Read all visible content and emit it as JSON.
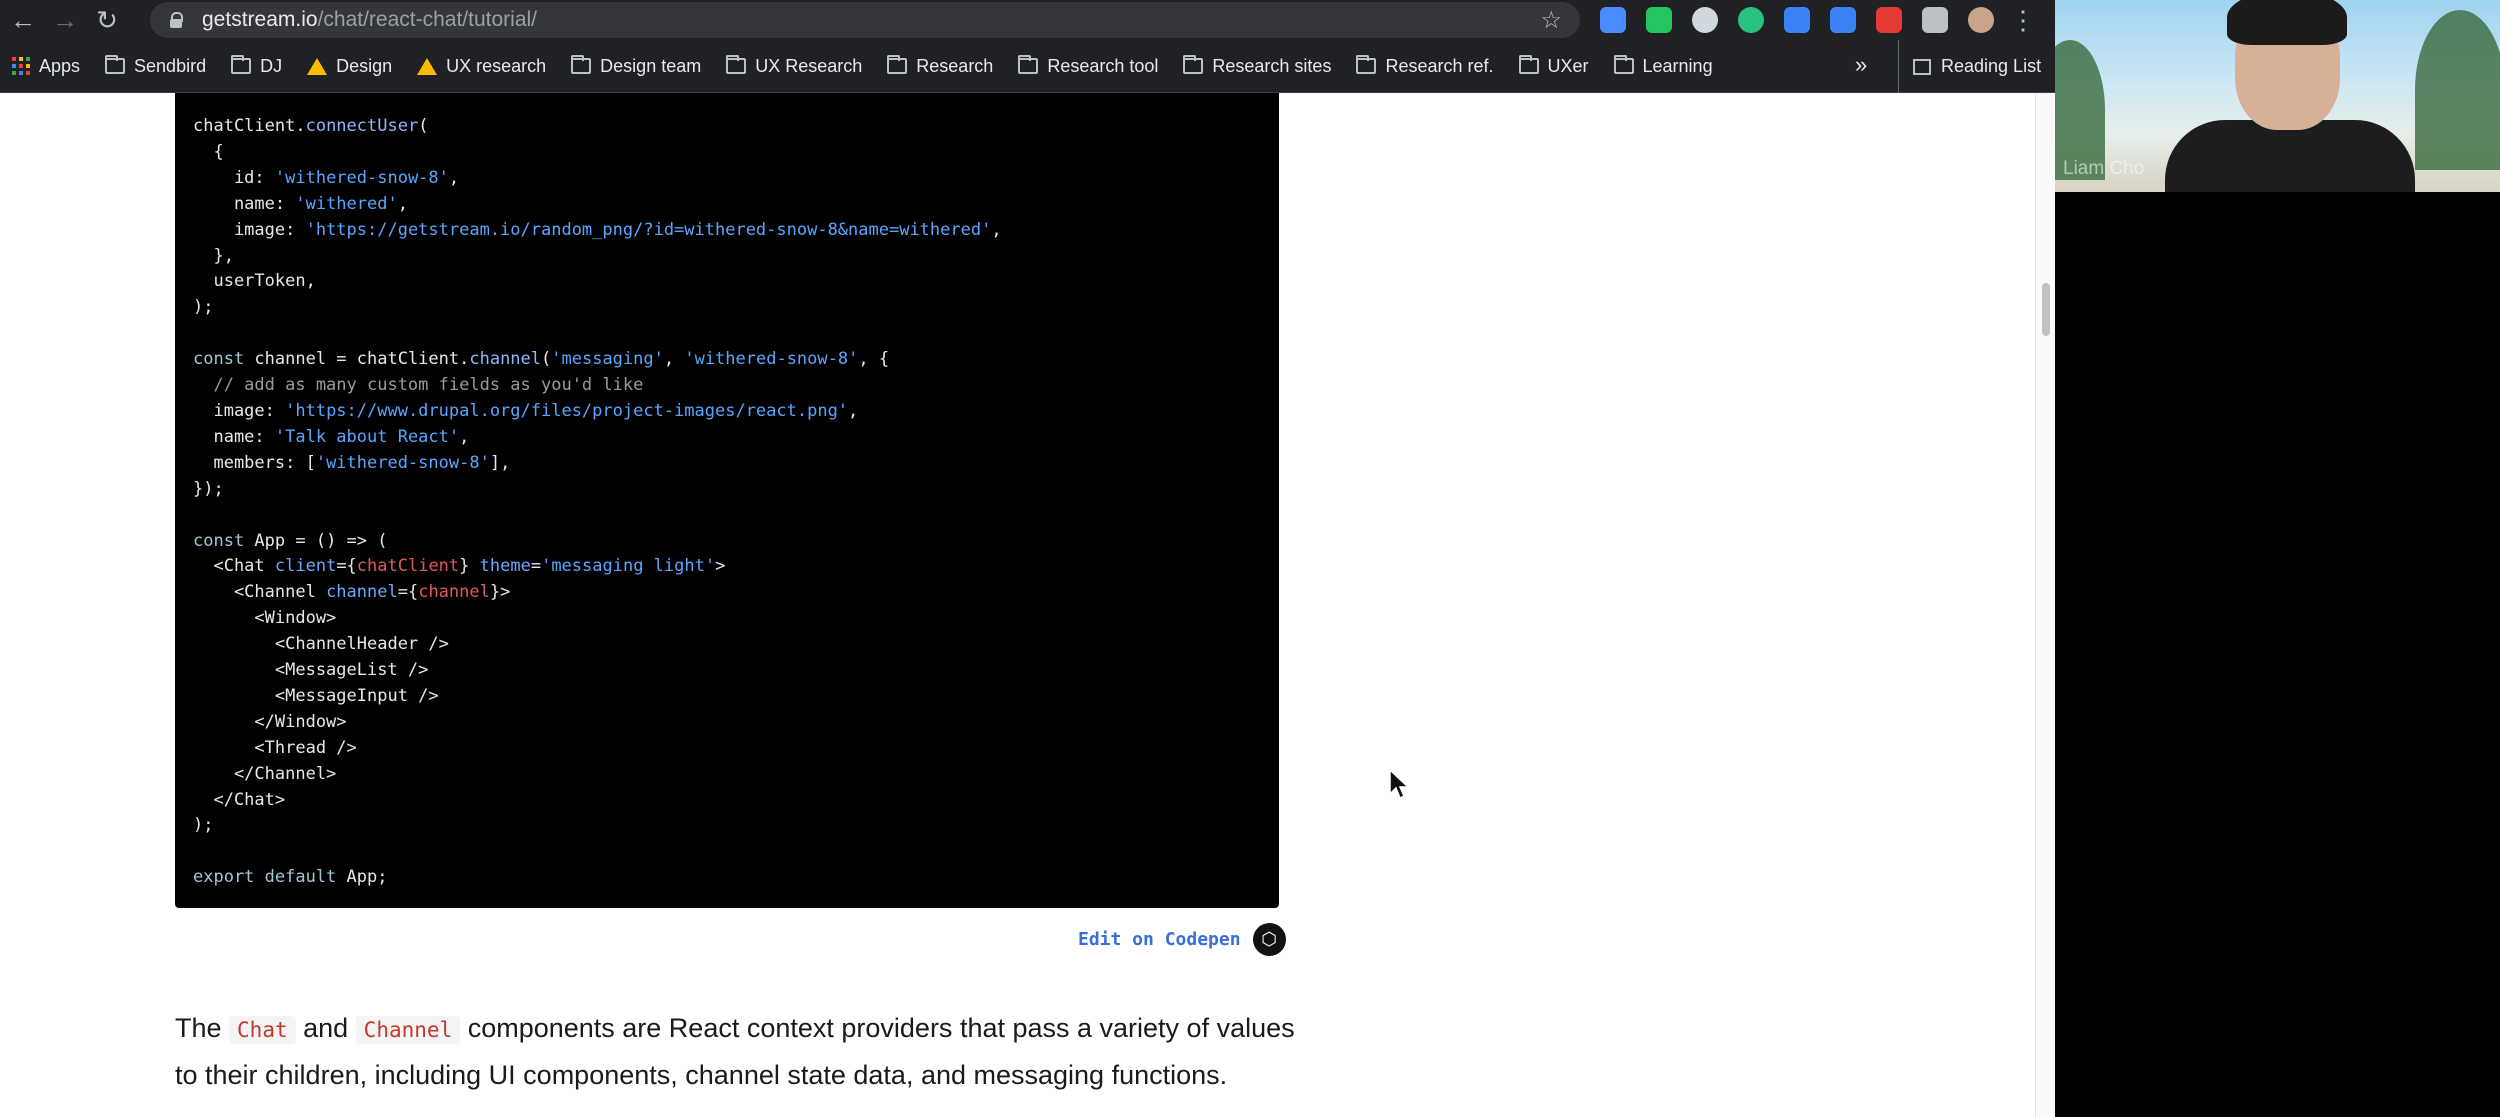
{
  "browser": {
    "url_host": "getstream.io",
    "url_path": "/chat/react-chat/tutorial/",
    "bookmarks": [
      {
        "label": "Apps",
        "icon": "apps-grid-icon"
      },
      {
        "label": "Sendbird",
        "icon": "folder-icon"
      },
      {
        "label": "DJ",
        "icon": "folder-icon"
      },
      {
        "label": "Design",
        "icon": "google-drive-icon"
      },
      {
        "label": "UX research",
        "icon": "google-drive-icon"
      },
      {
        "label": "Design team",
        "icon": "folder-icon"
      },
      {
        "label": "UX Research",
        "icon": "folder-icon"
      },
      {
        "label": "Research",
        "icon": "folder-icon"
      },
      {
        "label": "Research tool",
        "icon": "folder-icon"
      },
      {
        "label": "Research sites",
        "icon": "folder-icon"
      },
      {
        "label": "Research ref.",
        "icon": "folder-icon"
      },
      {
        "label": "UXer",
        "icon": "folder-icon"
      },
      {
        "label": "Learning",
        "icon": "folder-icon"
      }
    ],
    "more_bookmarks": "»",
    "reading_list": "Reading List",
    "extension_colors": [
      "#4a8cff",
      "#22c55e",
      "#cfd8dc",
      "#27c281",
      "#3b82f6",
      "#3b82f6",
      "#e53935",
      "#bdc1c6"
    ]
  },
  "code": {
    "lines": [
      "chatClient.connectUser(",
      "  {",
      "    id: 'withered-snow-8',",
      "    name: 'withered',",
      "    image: 'https://getstream.io/random_png/?id=withered-snow-8&name=withered',",
      "  },",
      "  userToken,",
      ");",
      "",
      "const channel = chatClient.channel('messaging', 'withered-snow-8', {",
      "  // add as many custom fields as you'd like",
      "  image: 'https://www.drupal.org/files/project-images/react.png',",
      "  name: 'Talk about React',",
      "  members: ['withered-snow-8'],",
      "});",
      "",
      "const App = () => (",
      "  <Chat client={chatClient} theme='messaging light'>",
      "    <Channel channel={channel}>",
      "      <Window>",
      "        <ChannelHeader />",
      "        <MessageList />",
      "        <MessageInput />",
      "      </Window>",
      "      <Thread />",
      "    </Channel>",
      "  </Chat>",
      ");",
      "",
      "export default App;"
    ]
  },
  "codepen": {
    "label": "Edit on Codepen"
  },
  "paragraph": {
    "part1": "The ",
    "code1": "Chat",
    "part2": " and ",
    "code2": "Channel",
    "part3": " components are React context providers that pass a variety of values to their children, including UI components, channel state data, and messaging functions."
  },
  "video_call": {
    "participant_name": "Liam Cho"
  }
}
